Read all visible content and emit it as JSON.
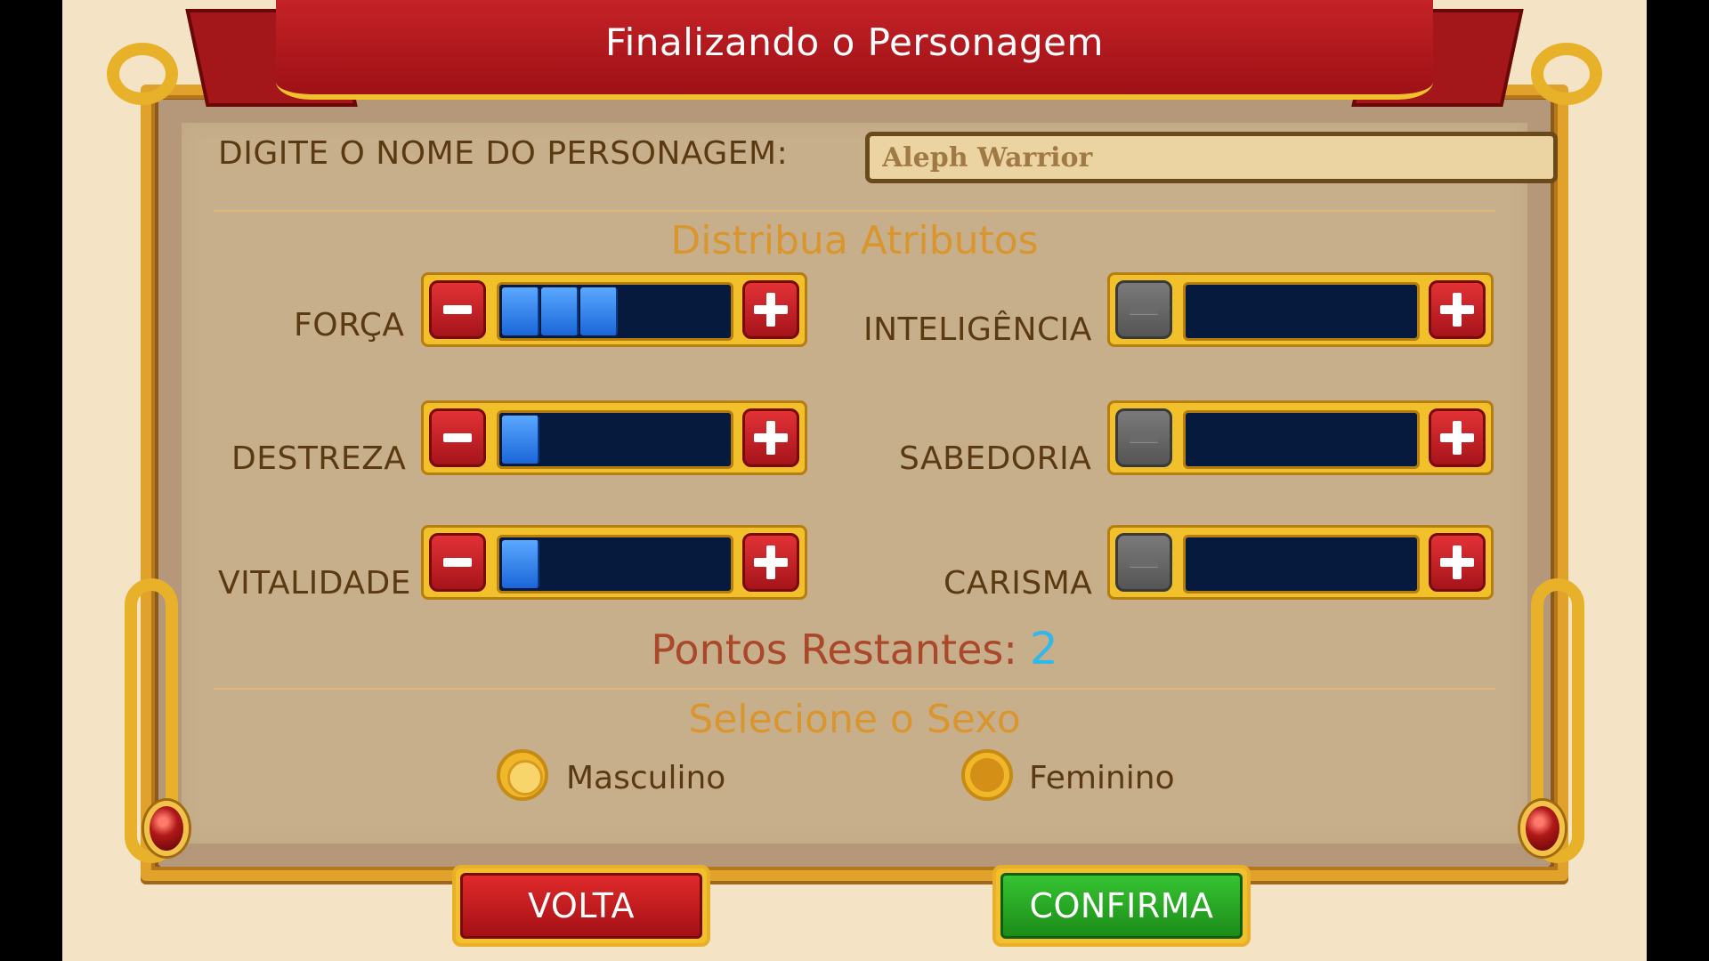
{
  "title": "Finalizando o Personagem",
  "name_prompt": "DIGITE O NOME DO PERSONAGEM:",
  "name_value": "Aleph Warrior",
  "attributes_title": "Distribua Atributos",
  "attributes": {
    "forca": {
      "label": "FORÇA",
      "level": 3
    },
    "destreza": {
      "label": "DESTREZA",
      "level": 1
    },
    "vitalidade": {
      "label": "VITALIDADE",
      "level": 1
    },
    "inteligencia": {
      "label": "INTELIGÊNCIA",
      "level": 0
    },
    "sabedoria": {
      "label": "SABEDORIA",
      "level": 0
    },
    "carisma": {
      "label": "CARISMA",
      "level": 0
    }
  },
  "remaining_label": "Pontos Restantes:",
  "remaining_points": "2",
  "sex_title": "Selecione o Sexo",
  "sex_options": {
    "male": {
      "label": "Masculino",
      "selected": true
    },
    "female": {
      "label": "Feminino",
      "selected": false
    }
  },
  "buttons": {
    "back": "VOLTA",
    "confirm": "CONFIRMA"
  },
  "colors": {
    "banner": "#b3171c",
    "frame_gold": "#e0a22a",
    "parchment": "#c8af8b",
    "bar_fill": "#2a7ae8",
    "remaining_number": "#2fb8e8"
  },
  "icons": {
    "decrease": "minus-icon",
    "increase": "plus-icon"
  }
}
